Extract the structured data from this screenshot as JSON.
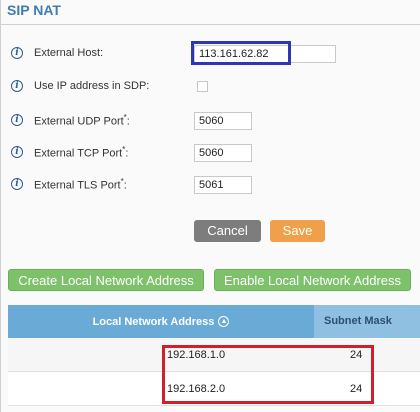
{
  "section": {
    "title": "SIP NAT"
  },
  "fields": {
    "external_host": {
      "label": "External Host:",
      "value": "113.161.62.82"
    },
    "use_ip_sdp": {
      "label": "Use IP address in SDP:",
      "checked": false
    },
    "udp_port": {
      "label": "External UDP Port",
      "asterisk": "*",
      "colon": ":",
      "value": "5060"
    },
    "tcp_port": {
      "label": "External TCP Port",
      "asterisk": "*",
      "colon": ":",
      "value": "5060"
    },
    "tls_port": {
      "label": "External TLS Port",
      "asterisk": "*",
      "colon": ":",
      "value": "5061"
    }
  },
  "actions": {
    "cancel_label": "Cancel",
    "save_label": "Save"
  },
  "network_buttons": {
    "create_label": "Create Local Network Address",
    "enable_label": "Enable Local Network Address"
  },
  "table": {
    "headers": {
      "network": "Local Network Address",
      "mask": "Subnet Mask"
    },
    "rows": [
      {
        "address": "192.168.1.0",
        "mask": "24"
      },
      {
        "address": "192.168.2.0",
        "mask": "24"
      }
    ]
  },
  "icons": {
    "info": "info-icon",
    "sort": "sort-up-icon"
  },
  "colors": {
    "title": "#3e7cb3",
    "cancel": "#7d7d7d",
    "save": "#f0a04a",
    "green_button": "#7dc16b",
    "header": "#6aaad6",
    "highlight_blue": "#2f36b3",
    "highlight_red": "#d21f2a"
  }
}
